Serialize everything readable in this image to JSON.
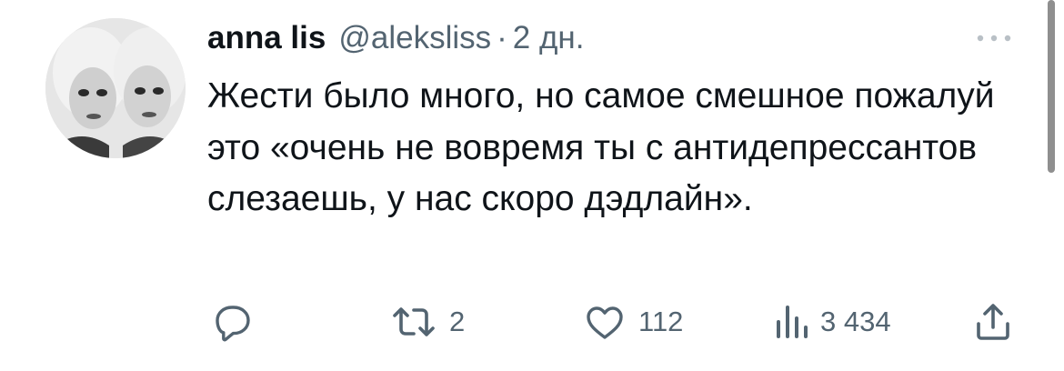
{
  "tweet": {
    "display_name": "anna lis",
    "handle": "@aleksliss",
    "separator": "·",
    "time": "2 дн.",
    "text": "Жести было много, но самое смешное пожалуй это «очень не вовремя ты с антидепрессантов слезаешь, у нас скоро дэдлайн»."
  },
  "actions": {
    "reply": {
      "icon": "reply-icon"
    },
    "retweet": {
      "icon": "retweet-icon",
      "count": "2"
    },
    "like": {
      "icon": "heart-icon",
      "count": "112"
    },
    "views": {
      "icon": "views-icon",
      "count": "3 434"
    },
    "share": {
      "icon": "share-icon"
    }
  },
  "more_menu": {
    "icon": "more-icon"
  },
  "colors": {
    "text": "#0f1419",
    "secondary": "#536471",
    "background": "#ffffff"
  }
}
